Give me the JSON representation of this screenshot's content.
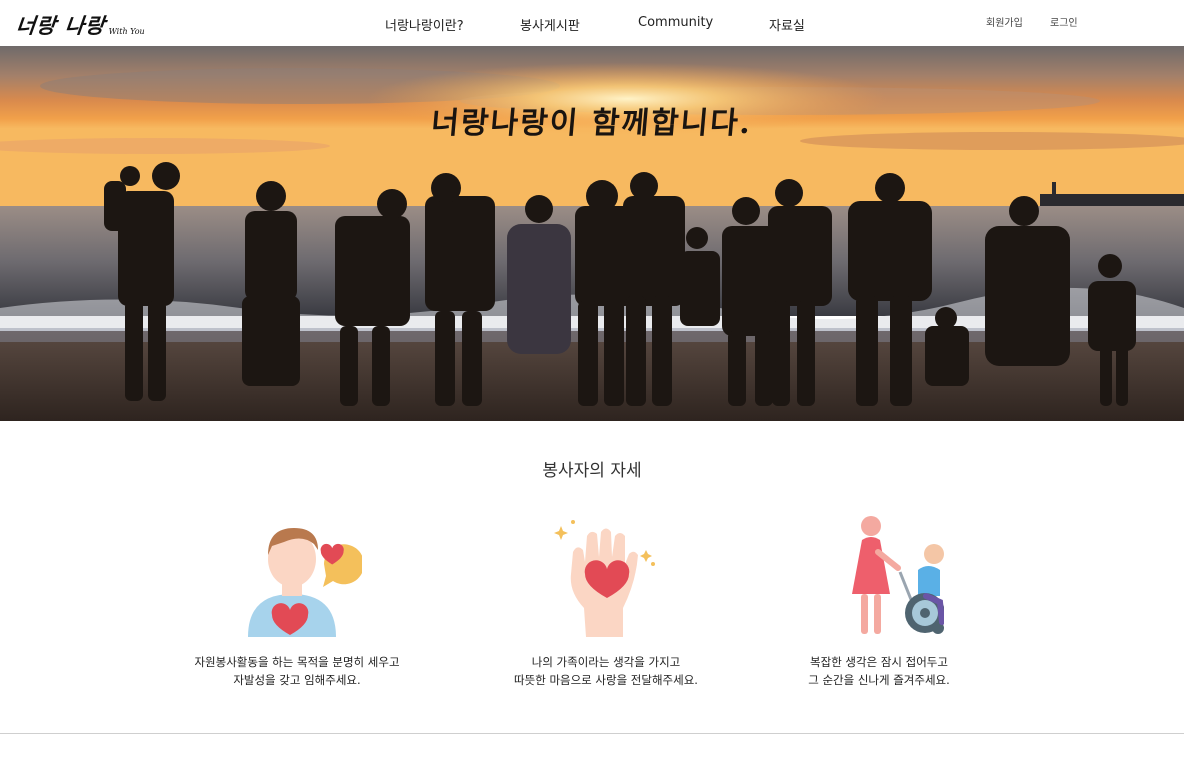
{
  "header": {
    "logo": {
      "main": "너랑 나랑",
      "sub": "With You"
    },
    "nav": [
      {
        "label": "너랑나랑이란?"
      },
      {
        "label": "봉사게시판"
      },
      {
        "label": "Community"
      },
      {
        "label": "자료실"
      }
    ],
    "auth": {
      "signup": "회원가입",
      "login": "로그인"
    }
  },
  "hero": {
    "title": "너랑나랑이 함께합니다."
  },
  "attitude": {
    "title": "봉사자의 자세",
    "cards": [
      {
        "icon": "volunteer-heart-person-icon",
        "line1": "자원봉사활동을 하는 목적을 분명히 세우고",
        "line2": "자발성을 갖고 임해주세요."
      },
      {
        "icon": "hand-holding-heart-icon",
        "line1": "나의 가족이라는 생각을 가지고",
        "line2": "따뜻한 마음으로 사랑을 전달해주세요."
      },
      {
        "icon": "wheelchair-helper-icon",
        "line1": "복잡한 생각은 잠시 접어두고",
        "line2": "그 순간을 신나게 즐겨주세요."
      }
    ]
  },
  "colors": {
    "heart": "#e24a55",
    "sunset_orange": "#e8843a",
    "silhouette": "#1c1612"
  }
}
